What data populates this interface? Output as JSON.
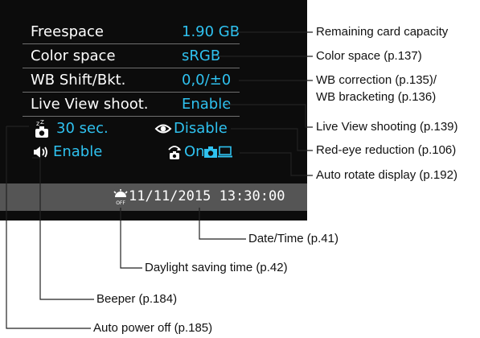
{
  "screen": {
    "rows": [
      {
        "label": "Freespace",
        "value": "1.90 GB"
      },
      {
        "label": "Color space",
        "value": "sRGB"
      },
      {
        "label": "WB Shift/Bkt.",
        "value": "0,0/±0"
      },
      {
        "label": "Live View shoot.",
        "value": "Enable"
      }
    ],
    "auto_power_off": "30 sec.",
    "red_eye": "Disable",
    "beeper": "Enable",
    "auto_rotate": "On",
    "datetime": "11/11/2015 13:30:00"
  },
  "callouts": {
    "remaining_capacity": "Remaining card capacity",
    "color_space": "Color space (p.137)",
    "wb_correction_1": "WB correction (p.135)/",
    "wb_correction_2": "WB bracketing (p.136)",
    "live_view": "Live View shooting (p.139)",
    "red_eye": "Red-eye reduction (p.106)",
    "auto_rotate": "Auto rotate display (p.192)",
    "date_time": "Date/Time (p.41)",
    "daylight_saving": "Daylight saving time (p.42)",
    "beeper": "Beeper (p.184)",
    "auto_power_off": "Auto power off (p.185)"
  },
  "colors": {
    "screen_bg": "#0c0c0c",
    "value_text": "#2fc2f0",
    "date_bar": "#555555",
    "leader_line": "#222222"
  },
  "icons": [
    "auto-power-off-icon",
    "red-eye-icon",
    "beeper-icon",
    "auto-rotate-icon",
    "camera-icon",
    "monitor-icon",
    "daylight-saving-icon"
  ]
}
